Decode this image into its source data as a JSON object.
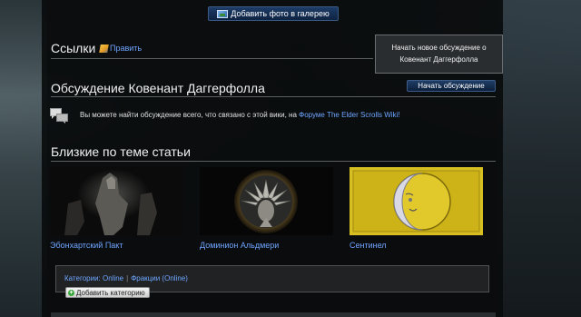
{
  "gallery": {
    "add_photo_label": "Добавить фото в галерею"
  },
  "links": {
    "title": "Ссылки",
    "edit_label": "Править"
  },
  "tooltip": {
    "text_line1": "Начать новое обсуждение о",
    "text_line2": "Ковенант Даггерфолла"
  },
  "discussion": {
    "title": "Обсуждение Ковенант Даггерфолла",
    "start_button_label": "Начать обсуждение",
    "info_text": "Вы можете найти обсуждение всего, что связано с этой вики, на ",
    "forum_link": "Форуме The Elder Scrolls Wiki!"
  },
  "related": {
    "title": "Близкие по теме статьи",
    "items": [
      {
        "label": "Эбонхартский Пакт"
      },
      {
        "label": "Доминион Альдмери"
      },
      {
        "label": "Сентинел"
      }
    ]
  },
  "categories": {
    "prefix": "Категории:",
    "items": [
      "Online",
      "Фракции (Online)"
    ],
    "add_label": "Добавить категорию"
  },
  "colors": {
    "link": "#6ea5ff",
    "button": "#102a4d",
    "rule": "#5a5f62"
  }
}
